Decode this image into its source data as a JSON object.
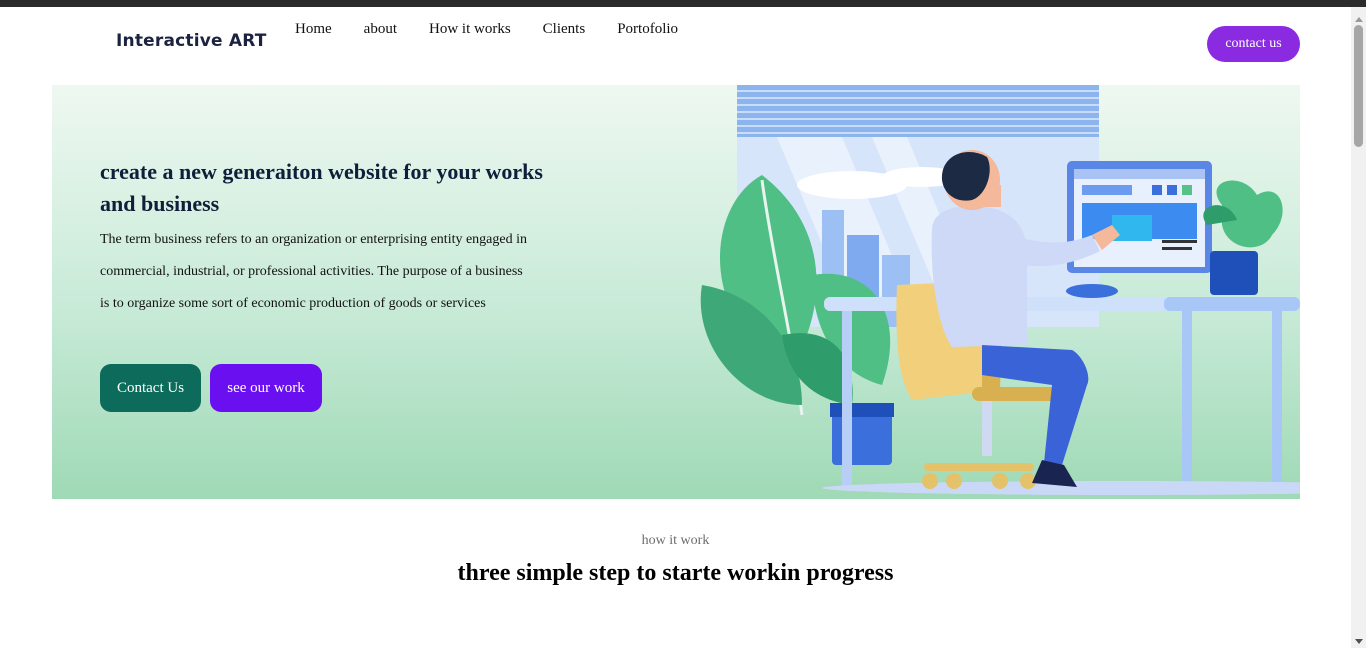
{
  "header": {
    "logo": "Interactive ART",
    "nav": [
      "Home",
      "about",
      "How it works",
      "Clients",
      "Portofolio"
    ],
    "cta": "contact us"
  },
  "hero": {
    "title": "create a new generaiton website for your works and business",
    "description": "The term business refers to an organization or enterprising entity engaged in commercial, industrial, or professional activities. The purpose of a business is to organize some sort of economic production of goods or services",
    "primary_button": "Contact Us",
    "secondary_button": "see our work",
    "illustration": "person-at-desk-illustration"
  },
  "section": {
    "subtitle": "how it work",
    "title": "three simple step to starte workin progress"
  },
  "colors": {
    "accent_purple": "#8a2be2",
    "button_violet": "#6a0ff0",
    "button_teal": "#0c6b5a",
    "hero_green": "#9fd9b5"
  }
}
